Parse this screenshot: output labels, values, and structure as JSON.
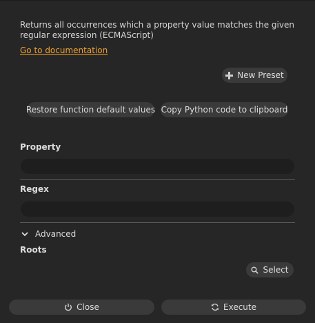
{
  "description": {
    "text": "Returns all occurrences which a property value matches the given regular expression (ECMAScript)",
    "link": "Go to documentation"
  },
  "buttons": {
    "new_preset": "New Preset",
    "restore": "Restore function default values",
    "copy_python": "Copy Python code to clipboard",
    "select": "Select",
    "close": "Close",
    "execute": "Execute"
  },
  "fields": {
    "property": {
      "label": "Property",
      "value": ""
    },
    "regex": {
      "label": "Regex",
      "value": ""
    }
  },
  "advanced": {
    "label": "Advanced"
  },
  "roots": {
    "label": "Roots"
  },
  "icons": {
    "new_preset": "plus-icon",
    "advanced": "chevron-down-icon",
    "select": "search-icon",
    "close": "power-icon",
    "execute": "refresh-icon"
  },
  "colors": {
    "background": "#262626",
    "button": "#3a3a3a",
    "field": "#1e1e1e",
    "link": "#f0a030",
    "text": "#d6d6d6"
  }
}
